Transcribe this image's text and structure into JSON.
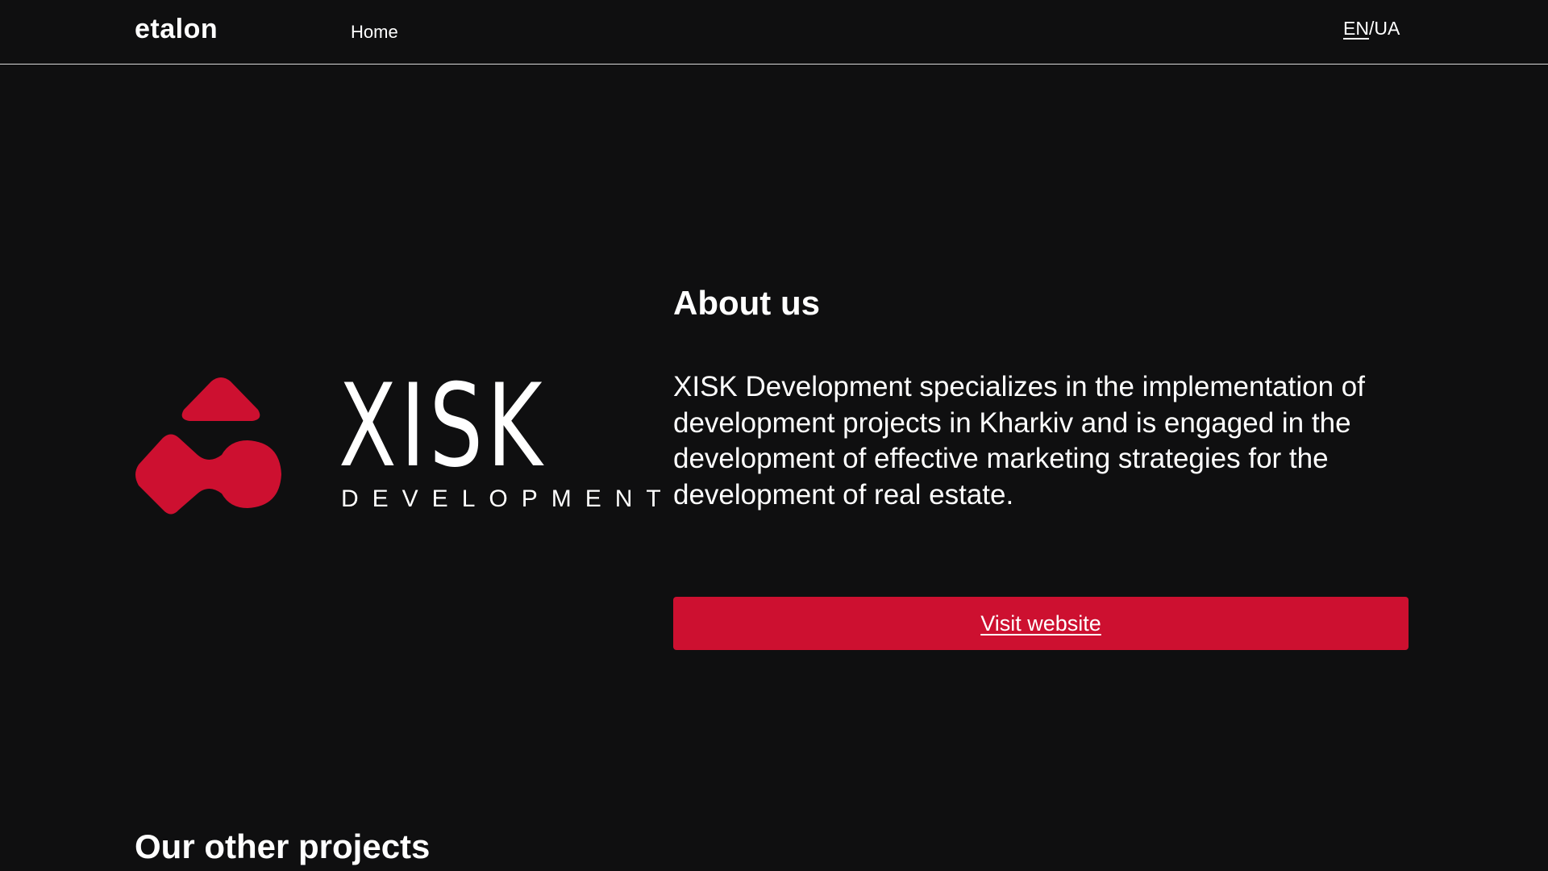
{
  "header": {
    "brand": "etalon",
    "nav": {
      "home": "Home"
    },
    "lang": {
      "en": "EN",
      "separator": "/",
      "ua": "UA"
    }
  },
  "logo": {
    "word": "XISK",
    "sub": "DEVELOPMENT",
    "accent_color": "#cd1030"
  },
  "about": {
    "title": "About us",
    "text": "XISK Development specializes in the implementation of development projects in Kharkiv and is engaged in the development of effective marketing strategies for the development of real estate.",
    "button_label": "Visit website"
  },
  "projects": {
    "title": "Our other projects"
  },
  "colors": {
    "background": "#0f0f10",
    "accent": "#cd1030",
    "text": "#ffffff"
  }
}
